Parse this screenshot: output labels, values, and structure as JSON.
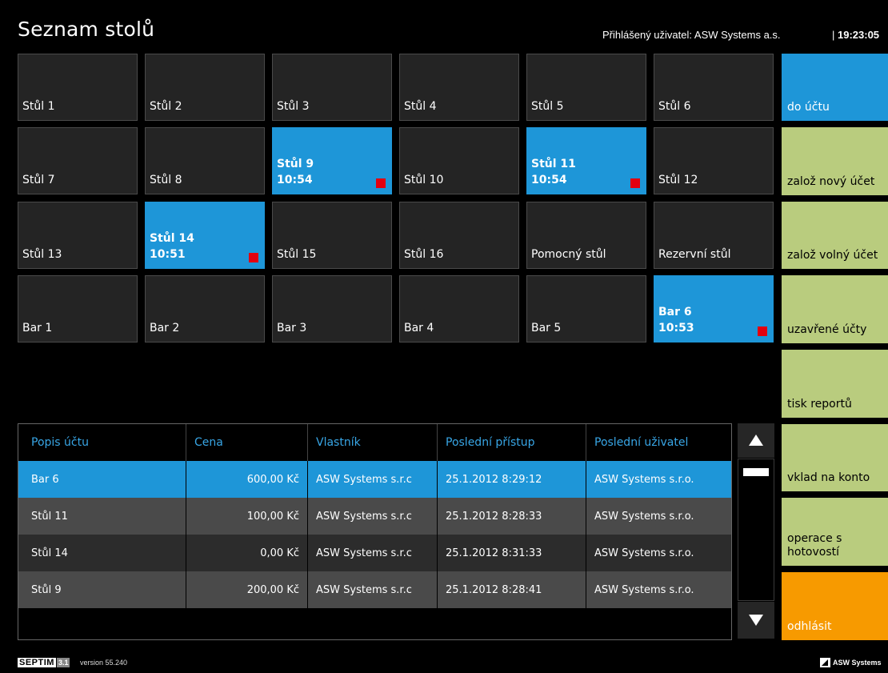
{
  "header": {
    "title": "Seznam stolů",
    "user_info": "Přihlášený uživatel: ASW Systems a.s.",
    "clock_sep": "|",
    "clock": "19:23:05"
  },
  "tiles": [
    {
      "name": "Stůl 1",
      "time": "",
      "occupied": false
    },
    {
      "name": "Stůl 2",
      "time": "",
      "occupied": false
    },
    {
      "name": "Stůl 3",
      "time": "",
      "occupied": false
    },
    {
      "name": "Stůl 4",
      "time": "",
      "occupied": false
    },
    {
      "name": "Stůl 5",
      "time": "",
      "occupied": false
    },
    {
      "name": "Stůl 6",
      "time": "",
      "occupied": false
    },
    {
      "name": "Stůl 7",
      "time": "",
      "occupied": false
    },
    {
      "name": "Stůl 8",
      "time": "",
      "occupied": false
    },
    {
      "name": "Stůl 9",
      "time": "10:54",
      "occupied": true
    },
    {
      "name": "Stůl 10",
      "time": "",
      "occupied": false
    },
    {
      "name": "Stůl 11",
      "time": "10:54",
      "occupied": true
    },
    {
      "name": "Stůl 12",
      "time": "",
      "occupied": false
    },
    {
      "name": "Stůl 13",
      "time": "",
      "occupied": false
    },
    {
      "name": "Stůl 14",
      "time": "10:51",
      "occupied": true
    },
    {
      "name": "Stůl 15",
      "time": "",
      "occupied": false
    },
    {
      "name": "Stůl 16",
      "time": "",
      "occupied": false
    },
    {
      "name": "Pomocný stůl",
      "time": "",
      "occupied": false
    },
    {
      "name": "Rezervní stůl",
      "time": "",
      "occupied": false
    },
    {
      "name": "Bar 1",
      "time": "",
      "occupied": false
    },
    {
      "name": "Bar 2",
      "time": "",
      "occupied": false
    },
    {
      "name": "Bar 3",
      "time": "",
      "occupied": false
    },
    {
      "name": "Bar 4",
      "time": "",
      "occupied": false
    },
    {
      "name": "Bar 5",
      "time": "",
      "occupied": false
    },
    {
      "name": "Bar 6",
      "time": "10:53",
      "occupied": true
    }
  ],
  "side_buttons": [
    {
      "label": "do účtu",
      "color": "#1e96d8"
    },
    {
      "label": "založ nový účet",
      "color": "#b9cc7e"
    },
    {
      "label": "založ volný účet",
      "color": "#b9cc7e"
    },
    {
      "label": "uzavřené účty",
      "color": "#b9cc7e"
    },
    {
      "label": "tisk reportů",
      "color": "#b9cc7e"
    },
    {
      "label": "vklad na konto",
      "color": "#b9cc7e"
    },
    {
      "label": "operace s hotovostí",
      "color": "#b9cc7e"
    },
    {
      "label": "odhlásit",
      "color": "#f79a00"
    }
  ],
  "accounts": {
    "columns": [
      "Popis účtu",
      "Cena",
      "Vlastník",
      "Poslední přístup",
      "Poslední uživatel"
    ],
    "rows": [
      [
        "Bar 6",
        "600,00 Kč",
        "ASW Systems s.r.c",
        "25.1.2012 8:29:12",
        "ASW Systems s.r.o."
      ],
      [
        "Stůl 11",
        "100,00 Kč",
        "ASW Systems s.r.c",
        "25.1.2012 8:28:33",
        "ASW Systems s.r.o."
      ],
      [
        "Stůl 14",
        "0,00 Kč",
        "ASW Systems s.r.c",
        "25.1.2012 8:31:33",
        "ASW Systems s.r.o."
      ],
      [
        "Stůl 9",
        "200,00 Kč",
        "ASW Systems s.r.c",
        "25.1.2012 8:28:41",
        "ASW Systems s.r.o."
      ]
    ],
    "selected_row": 0
  },
  "footer": {
    "septim": "SEPTIM",
    "septim_version_badge": "3.1",
    "version": "version  55.240",
    "asw": "ASW Systems"
  },
  "colors": {
    "accent": "#1e96d8",
    "occupied_marker": "#e3000f",
    "action": "#b9cc7e",
    "logout": "#f79a00"
  }
}
